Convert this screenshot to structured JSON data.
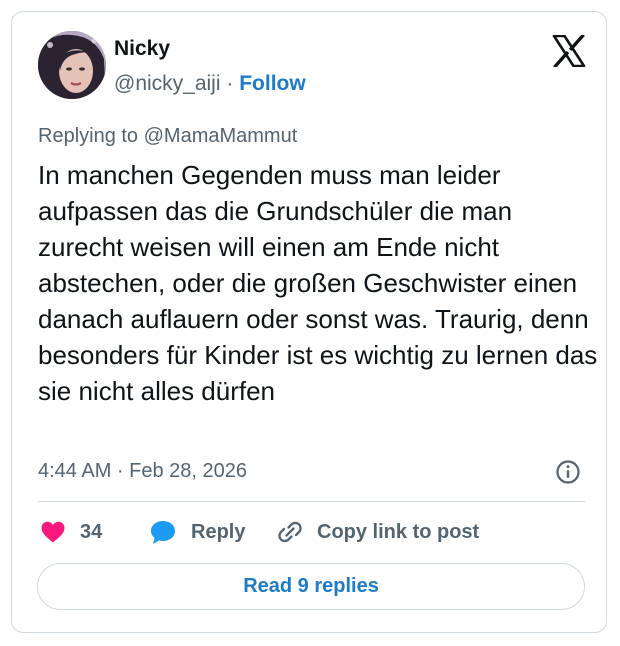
{
  "author": {
    "name": "Nicky",
    "handle": "@nicky_aiji",
    "separator": "·",
    "follow_label": "Follow"
  },
  "reply_context": "Replying to @MamaMammut",
  "tweet": {
    "text": "In manchen Gegenden muss man leider aufpassen das die Grundschüler die man zurecht weisen will einen am Ende nicht abstechen, oder die großen Geschwister einen danach auflauern oder sonst was. Traurig, denn besonders für Kinder ist es wichtig zu lernen das sie nicht alles dürfen",
    "timestamp": "4:44 AM · Feb 28, 2026"
  },
  "actions": {
    "like_count": "34",
    "reply_label": "Reply",
    "copy_label": "Copy link to post"
  },
  "read_replies_label": "Read 9 replies",
  "icons": {
    "logo": "x-logo-icon",
    "info": "info-icon",
    "like": "heart-icon",
    "reply": "speech-bubble-icon",
    "copy": "link-icon"
  },
  "colors": {
    "link": "#1d7bc9",
    "heart": "#f91880",
    "reply": "#1d9bf0",
    "text": "#0f1419",
    "muted": "#536471",
    "border": "#cfd9de"
  }
}
